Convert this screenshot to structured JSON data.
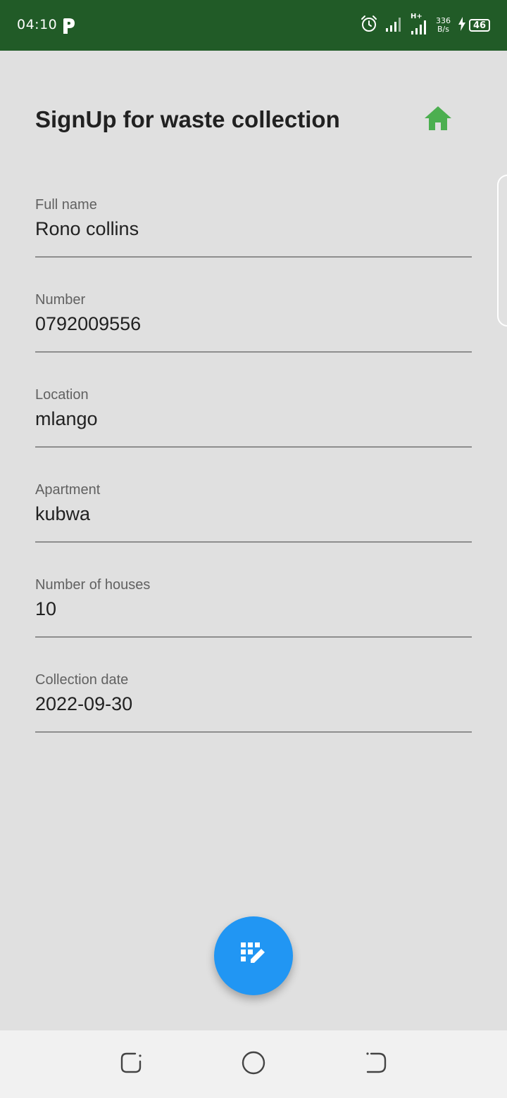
{
  "status_bar": {
    "time": "04:10",
    "network_speed_value": "336",
    "network_speed_unit": "B/s",
    "network_type": "H+",
    "battery_level": "46",
    "background_color": "#215b27",
    "icons": [
      "parking-icon",
      "alarm-icon",
      "signal-icon",
      "signal-hplus-icon",
      "charging-icon",
      "battery-icon"
    ]
  },
  "header": {
    "title": "SignUp for waste collection",
    "home_icon": "home-icon",
    "home_icon_color": "#4caf50"
  },
  "form": {
    "fields": [
      {
        "label": "Full name",
        "value": "Rono collins"
      },
      {
        "label": "Number",
        "value": "0792009556"
      },
      {
        "label": "Location",
        "value": "mlango"
      },
      {
        "label": "Apartment",
        "value": "kubwa"
      },
      {
        "label": "Number of houses",
        "value": "10"
      },
      {
        "label": "Collection date",
        "value": "2022-09-30"
      }
    ]
  },
  "fab": {
    "icon": "edit-calendar-icon",
    "color": "#2196f3"
  },
  "navigation_bar": {
    "buttons": [
      "recents-icon",
      "home-circle-icon",
      "back-icon"
    ]
  }
}
